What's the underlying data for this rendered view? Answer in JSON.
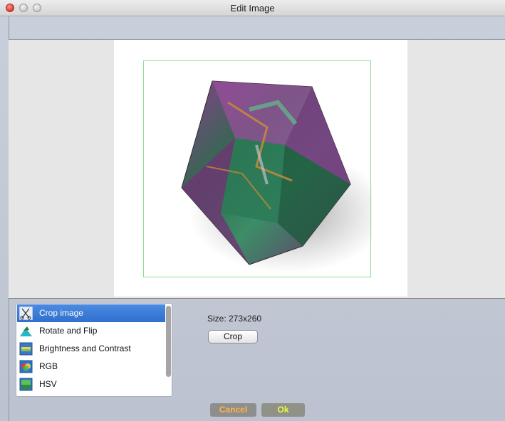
{
  "window": {
    "title": "Edit Image"
  },
  "tools": {
    "items": [
      {
        "label": "Crop image",
        "icon": "scissors-icon",
        "selected": true
      },
      {
        "label": "Rotate and Flip",
        "icon": "rotate-flip-icon",
        "selected": false
      },
      {
        "label": "Brightness and Contrast",
        "icon": "brightness-contrast-icon",
        "selected": false
      },
      {
        "label": "RGB",
        "icon": "rgb-icon",
        "selected": false
      },
      {
        "label": "HSV",
        "icon": "hsv-icon",
        "selected": false
      }
    ]
  },
  "crop_panel": {
    "size_text": "Size: 273x260",
    "crop_button": "Crop"
  },
  "footer": {
    "cancel_label": "Cancel",
    "ok_label": "Ok"
  },
  "colors": {
    "selection_blue": "#3a7bd8",
    "crop_rect": "#8ddf8d",
    "cancel_text": "#ffb445",
    "ok_text": "#e8ff3a"
  }
}
